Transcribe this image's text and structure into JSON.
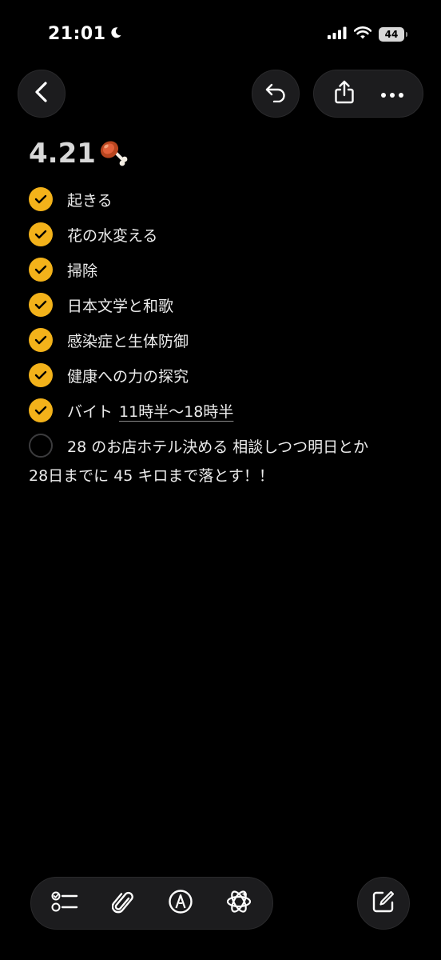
{
  "status_bar": {
    "time": "21:01",
    "battery": "44"
  },
  "toolbar": {
    "icons": [
      "back-chevron-icon",
      "undo-icon",
      "share-icon",
      "more-icon"
    ]
  },
  "note": {
    "title": "4.21",
    "title_emoji": "meat-on-bone",
    "checklist": [
      {
        "text": "起きる",
        "checked": true
      },
      {
        "text": "花の水変える",
        "checked": true
      },
      {
        "text": "掃除",
        "checked": true
      },
      {
        "text": "日本文学と和歌",
        "checked": true
      },
      {
        "text": "感染症と生体防御",
        "checked": true
      },
      {
        "text": "健康への力の探究",
        "checked": true
      },
      {
        "text": "バイト",
        "detail": "11時半〜18時半",
        "checked": true
      },
      {
        "text": "28 のお店ホテル決める 相談しつつ明日とか",
        "checked": false
      }
    ],
    "body": "28日までに 45 キロまで落とす！！"
  },
  "bottom_toolbar": {
    "icons": [
      "checklist-icon",
      "paperclip-icon",
      "markup-pen-icon",
      "apple-intelligence-icon",
      "compose-icon"
    ]
  },
  "colors": {
    "accent": "#f3b21a",
    "background": "#000000",
    "button_bg": "#1c1c1e"
  }
}
